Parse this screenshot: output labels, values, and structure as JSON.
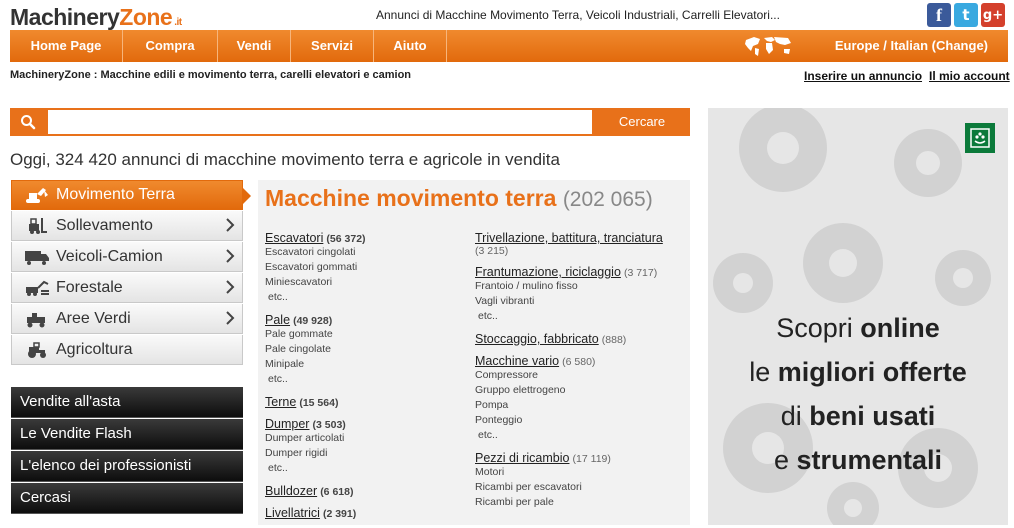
{
  "logo": {
    "machinery": "Machinery",
    "zone": "Zone",
    "tld": ".it"
  },
  "tagline": "Annunci di Macchine Movimento Terra, Veicoli Industriali, Carrelli Elevatori...",
  "social": {
    "facebook": "f",
    "twitter": "t",
    "google": "g+"
  },
  "nav": {
    "items": [
      "Home Page",
      "Compra",
      "Vendi",
      "Servizi",
      "Aiuto"
    ],
    "region": "Europe / Italian (Change)"
  },
  "breadcrumb": "MachineryZone : Macchine edili e movimento terra, carelli elevatori e camion",
  "links": {
    "insert": "Inserire un annuncio",
    "account": "Il mio account"
  },
  "search": {
    "value": "",
    "placeholder": "",
    "button": "Cercare"
  },
  "headline": "Oggi, 324 420 annunci di macchine movimento terra e agricole in vendita",
  "categories": [
    {
      "label": "Movimento Terra",
      "icon": "excavator-icon"
    },
    {
      "label": "Sollevamento",
      "icon": "forklift-icon"
    },
    {
      "label": "Veicoli-Camion",
      "icon": "truck-icon"
    },
    {
      "label": "Forestale",
      "icon": "forestry-icon"
    },
    {
      "label": "Aree Verdi",
      "icon": "mower-icon"
    },
    {
      "label": "Agricoltura",
      "icon": "tractor-icon"
    }
  ],
  "menu": [
    "Vendite all'asta",
    "Le Vendite Flash",
    "L'elenco dei professionisti",
    "Cercasi"
  ],
  "panel": {
    "title": "Macchine movimento terra",
    "count": "(202 065)",
    "left": [
      {
        "name": "Escavatori",
        "count": "(56 372)",
        "subs": [
          "Escavatori cingolati",
          "Escavatori gommati",
          "Miniescavatori"
        ],
        "etc": "etc.."
      },
      {
        "name": "Pale",
        "count": "(49 928)",
        "subs": [
          "Pale gommate",
          "Pale cingolate",
          "Minipale"
        ],
        "etc": "etc.."
      },
      {
        "name": "Terne",
        "count": "(15 564)",
        "subs": [],
        "etc": ""
      },
      {
        "name": "Dumper",
        "count": "(3 503)",
        "subs": [
          "Dumper articolati",
          "Dumper rigidi"
        ],
        "etc": "etc.."
      },
      {
        "name": "Bulldozer",
        "count": "(6 618)",
        "subs": [],
        "etc": ""
      },
      {
        "name": "Livellatrici",
        "count": "(2 391)",
        "subs": [],
        "etc": ""
      }
    ],
    "right": [
      {
        "name": "Trivellazione, battitura, tranciatura",
        "count": "(3 215)",
        "subs": [],
        "etc": ""
      },
      {
        "name": "Frantumazione, riciclaggio",
        "count": "(3 717)",
        "subs": [
          "Frantoio / mulino fisso",
          "Vagli vibranti"
        ],
        "etc": "etc.."
      },
      {
        "name": "Stoccaggio, fabbricato",
        "count": "(888)",
        "subs": [],
        "etc": ""
      },
      {
        "name": "Macchine vario",
        "count": "(6 580)",
        "subs": [
          "Compressore",
          "Gruppo elettrogeno",
          "Pompa",
          "Ponteggio"
        ],
        "etc": "etc.."
      },
      {
        "name": "Pezzi di ricambio",
        "count": "(17 119)",
        "subs": [
          "Motori",
          "Ricambi per escavatori",
          "Ricambi per pale"
        ],
        "etc": ""
      }
    ]
  },
  "ad": {
    "l1a": "Scopri ",
    "l1b": "online",
    "l2a": "le ",
    "l2b": "migliori offerte",
    "l3a": "di ",
    "l3b": "beni usati",
    "l4a": "e ",
    "l4b": "strumentali"
  },
  "colors": {
    "accent": "#e8711a",
    "dark": "#1a1a1a",
    "bank": "#0b7a3a"
  }
}
